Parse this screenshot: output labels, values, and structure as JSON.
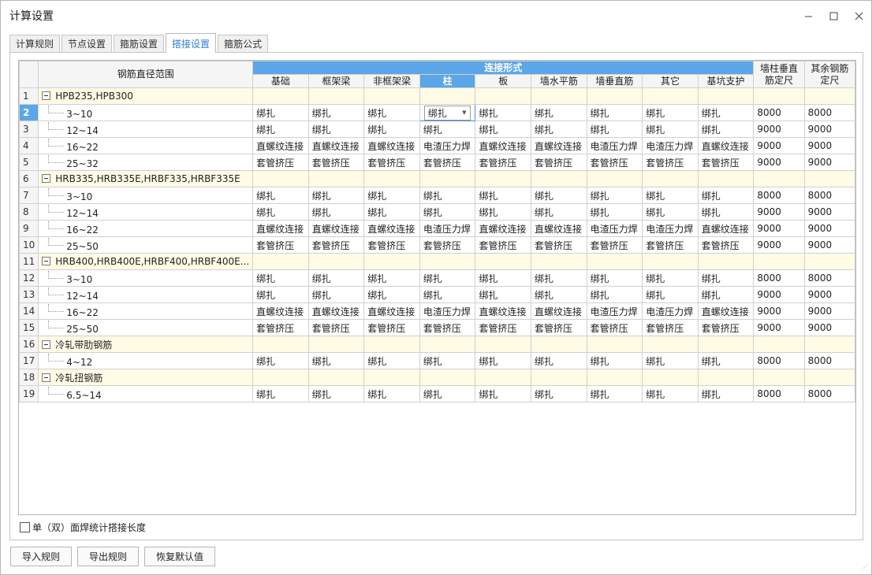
{
  "window": {
    "title": "计算设置"
  },
  "tabs": [
    {
      "label": "计算规则",
      "active": false
    },
    {
      "label": "节点设置",
      "active": false
    },
    {
      "label": "箍筋设置",
      "active": false
    },
    {
      "label": "搭接设置",
      "active": true
    },
    {
      "label": "箍筋公式",
      "active": false
    }
  ],
  "grid": {
    "headers": {
      "range": "钢筋直径范围",
      "group": "连接形式",
      "sub": [
        "基础",
        "框架梁",
        "非框架梁",
        "柱",
        "板",
        "墙水平筋",
        "墙垂直筋",
        "其它",
        "基坑支护"
      ],
      "wall_fixed": "墙柱垂直筋定尺",
      "other_fixed": "其余钢筋定尺"
    },
    "selected_column_index": 3,
    "selected_row_number": "2",
    "rows": [
      {
        "num": "1",
        "type": "group",
        "label": "HPB235,HPB300"
      },
      {
        "num": "2",
        "type": "item",
        "label": "3~10",
        "cells": [
          "绑扎",
          "绑扎",
          "绑扎",
          "绑扎",
          "绑扎",
          "绑扎",
          "绑扎",
          "绑扎",
          "绑扎"
        ],
        "wall": "8000",
        "other": "8000"
      },
      {
        "num": "3",
        "type": "item",
        "label": "12~14",
        "cells": [
          "绑扎",
          "绑扎",
          "绑扎",
          "绑扎",
          "绑扎",
          "绑扎",
          "绑扎",
          "绑扎",
          "绑扎"
        ],
        "wall": "9000",
        "other": "9000"
      },
      {
        "num": "4",
        "type": "item",
        "label": "16~22",
        "cells": [
          "直螺纹连接",
          "直螺纹连接",
          "直螺纹连接",
          "电渣压力焊",
          "直螺纹连接",
          "直螺纹连接",
          "电渣压力焊",
          "电渣压力焊",
          "直螺纹连接"
        ],
        "wall": "9000",
        "other": "9000"
      },
      {
        "num": "5",
        "type": "item",
        "label": "25~32",
        "cells": [
          "套管挤压",
          "套管挤压",
          "套管挤压",
          "套管挤压",
          "套管挤压",
          "套管挤压",
          "套管挤压",
          "套管挤压",
          "套管挤压"
        ],
        "wall": "9000",
        "other": "9000"
      },
      {
        "num": "6",
        "type": "group",
        "label": "HRB335,HRB335E,HRBF335,HRBF335E"
      },
      {
        "num": "7",
        "type": "item",
        "label": "3~10",
        "cells": [
          "绑扎",
          "绑扎",
          "绑扎",
          "绑扎",
          "绑扎",
          "绑扎",
          "绑扎",
          "绑扎",
          "绑扎"
        ],
        "wall": "8000",
        "other": "8000"
      },
      {
        "num": "8",
        "type": "item",
        "label": "12~14",
        "cells": [
          "绑扎",
          "绑扎",
          "绑扎",
          "绑扎",
          "绑扎",
          "绑扎",
          "绑扎",
          "绑扎",
          "绑扎"
        ],
        "wall": "9000",
        "other": "9000"
      },
      {
        "num": "9",
        "type": "item",
        "label": "16~22",
        "cells": [
          "直螺纹连接",
          "直螺纹连接",
          "直螺纹连接",
          "电渣压力焊",
          "直螺纹连接",
          "直螺纹连接",
          "电渣压力焊",
          "电渣压力焊",
          "直螺纹连接"
        ],
        "wall": "9000",
        "other": "9000"
      },
      {
        "num": "10",
        "type": "item",
        "label": "25~50",
        "cells": [
          "套管挤压",
          "套管挤压",
          "套管挤压",
          "套管挤压",
          "套管挤压",
          "套管挤压",
          "套管挤压",
          "套管挤压",
          "套管挤压"
        ],
        "wall": "9000",
        "other": "9000"
      },
      {
        "num": "11",
        "type": "group",
        "label": "HRB400,HRB400E,HRBF400,HRBF400E..."
      },
      {
        "num": "12",
        "type": "item",
        "label": "3~10",
        "cells": [
          "绑扎",
          "绑扎",
          "绑扎",
          "绑扎",
          "绑扎",
          "绑扎",
          "绑扎",
          "绑扎",
          "绑扎"
        ],
        "wall": "8000",
        "other": "8000"
      },
      {
        "num": "13",
        "type": "item",
        "label": "12~14",
        "cells": [
          "绑扎",
          "绑扎",
          "绑扎",
          "绑扎",
          "绑扎",
          "绑扎",
          "绑扎",
          "绑扎",
          "绑扎"
        ],
        "wall": "9000",
        "other": "9000"
      },
      {
        "num": "14",
        "type": "item",
        "label": "16~22",
        "cells": [
          "直螺纹连接",
          "直螺纹连接",
          "直螺纹连接",
          "电渣压力焊",
          "直螺纹连接",
          "直螺纹连接",
          "电渣压力焊",
          "电渣压力焊",
          "直螺纹连接"
        ],
        "wall": "9000",
        "other": "9000"
      },
      {
        "num": "15",
        "type": "item",
        "label": "25~50",
        "cells": [
          "套管挤压",
          "套管挤压",
          "套管挤压",
          "套管挤压",
          "套管挤压",
          "套管挤压",
          "套管挤压",
          "套管挤压",
          "套管挤压"
        ],
        "wall": "9000",
        "other": "9000"
      },
      {
        "num": "16",
        "type": "group",
        "label": "冷轧带肋钢筋"
      },
      {
        "num": "17",
        "type": "item",
        "label": "4~12",
        "cells": [
          "绑扎",
          "绑扎",
          "绑扎",
          "绑扎",
          "绑扎",
          "绑扎",
          "绑扎",
          "绑扎",
          "绑扎"
        ],
        "wall": "8000",
        "other": "8000"
      },
      {
        "num": "18",
        "type": "group",
        "label": "冷轧扭钢筋"
      },
      {
        "num": "19",
        "type": "item",
        "label": "6.5~14",
        "cells": [
          "绑扎",
          "绑扎",
          "绑扎",
          "绑扎",
          "绑扎",
          "绑扎",
          "绑扎",
          "绑扎",
          "绑扎"
        ],
        "wall": "8000",
        "other": "8000"
      }
    ]
  },
  "options": {
    "weld_checkbox_label": "单（双）面焊统计搭接长度",
    "weld_checked": false
  },
  "buttons": {
    "import": "导入规则",
    "export": "导出规则",
    "restore": "恢复默认值"
  },
  "icons": {
    "minimize": "minimize-icon",
    "maximize": "maximize-icon",
    "close": "close-icon",
    "collapse": "collapse-icon",
    "dropdown": "chevron-down-icon"
  },
  "colors": {
    "accent": "#5aa6e8",
    "active_tab_text": "#2f7fcf",
    "group_row_bg": "#fffbe5"
  }
}
